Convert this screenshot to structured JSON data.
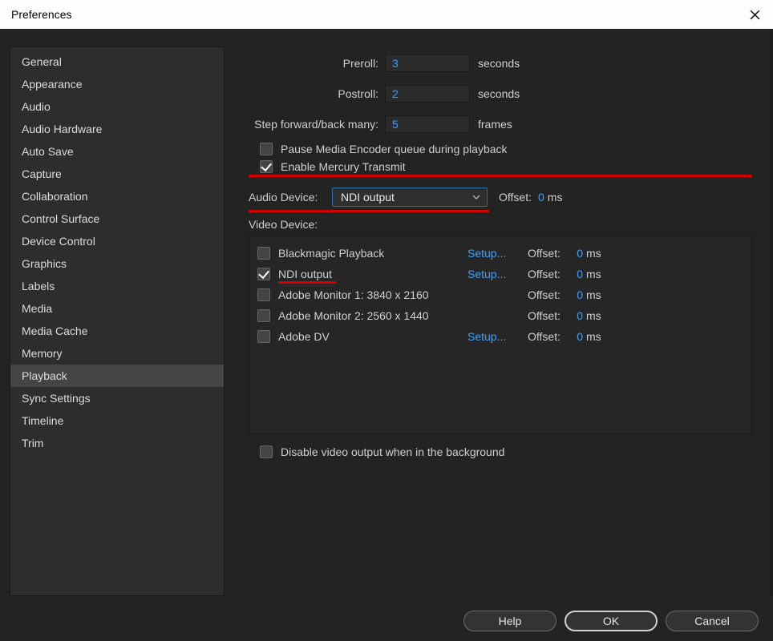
{
  "window": {
    "title": "Preferences"
  },
  "sidebar": {
    "items": [
      "General",
      "Appearance",
      "Audio",
      "Audio Hardware",
      "Auto Save",
      "Capture",
      "Collaboration",
      "Control Surface",
      "Device Control",
      "Graphics",
      "Labels",
      "Media",
      "Media Cache",
      "Memory",
      "Playback",
      "Sync Settings",
      "Timeline",
      "Trim"
    ],
    "selected": "Playback"
  },
  "fields": {
    "preroll_label": "Preroll:",
    "preroll_value": "3",
    "preroll_unit": "seconds",
    "postroll_label": "Postroll:",
    "postroll_value": "2",
    "postroll_unit": "seconds",
    "step_label": "Step forward/back many:",
    "step_value": "5",
    "step_unit": "frames",
    "pause_encoder": {
      "checked": false,
      "label": "Pause Media Encoder queue during playback"
    },
    "mercury": {
      "checked": true,
      "label": "Enable Mercury Transmit"
    },
    "audio_device_label": "Audio Device:",
    "audio_device_value": "NDI output",
    "audio_offset_label": "Offset:",
    "audio_offset_value": "0",
    "audio_offset_unit": "ms",
    "video_device_label": "Video Device:",
    "video_devices": [
      {
        "checked": false,
        "name": "Blackmagic Playback",
        "setup": "Setup...",
        "offset": "0",
        "ms": "ms"
      },
      {
        "checked": true,
        "name": "NDI output",
        "setup": "Setup...",
        "offset": "0",
        "ms": "ms"
      },
      {
        "checked": false,
        "name": "Adobe Monitor 1: 3840 x 2160",
        "setup": "",
        "offset": "0",
        "ms": "ms"
      },
      {
        "checked": false,
        "name": "Adobe Monitor 2: 2560 x 1440",
        "setup": "",
        "offset": "0",
        "ms": "ms"
      },
      {
        "checked": false,
        "name": "Adobe DV",
        "setup": "Setup...",
        "offset": "0",
        "ms": "ms"
      }
    ],
    "offset_label": "Offset:",
    "disable_bg": {
      "checked": false,
      "label": "Disable video output when in the background"
    }
  },
  "buttons": {
    "help": "Help",
    "ok": "OK",
    "cancel": "Cancel"
  }
}
